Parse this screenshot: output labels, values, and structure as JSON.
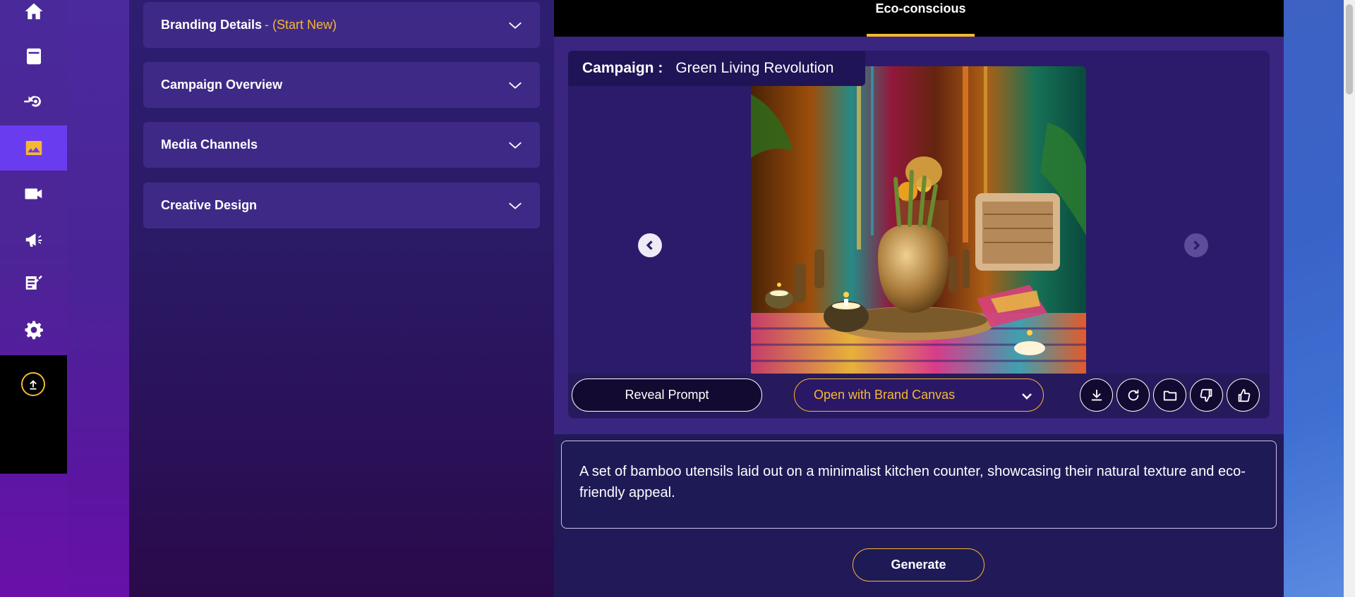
{
  "sidebar": {
    "items": [
      {
        "icon": "home-icon"
      },
      {
        "icon": "notebook-icon"
      },
      {
        "icon": "gear-arrow-icon"
      },
      {
        "icon": "image-icon",
        "active": true
      },
      {
        "icon": "video-camera-icon"
      },
      {
        "icon": "megaphone-icon"
      },
      {
        "icon": "edit-list-icon"
      },
      {
        "icon": "settings-gear-icon"
      }
    ],
    "upload_icon": "upload-icon"
  },
  "accordions": {
    "branding": {
      "title": "Branding Details",
      "suffix": " - (Start New)"
    },
    "campaign_overview": {
      "title": "Campaign Overview"
    },
    "media_channels": {
      "title": "Media Channels"
    },
    "creative_design": {
      "title": "Creative Design"
    }
  },
  "tabs": {
    "active": "Eco-conscious"
  },
  "preview": {
    "campaign_label": "Campaign :",
    "campaign_name": "Green Living Revolution"
  },
  "actions": {
    "reveal_prompt": "Reveal Prompt",
    "open_with": "Open with Brand Canvas"
  },
  "prompt": {
    "text": "A set of bamboo utensils laid out on a minimalist kitchen counter, showcasing their natural texture and eco-friendly appeal."
  },
  "generate": {
    "label": "Generate"
  },
  "colors": {
    "accent": "#f5b832",
    "active_nav": "#6a3cf0",
    "panel": "#3e2a86",
    "main_bg": "#221a58"
  }
}
